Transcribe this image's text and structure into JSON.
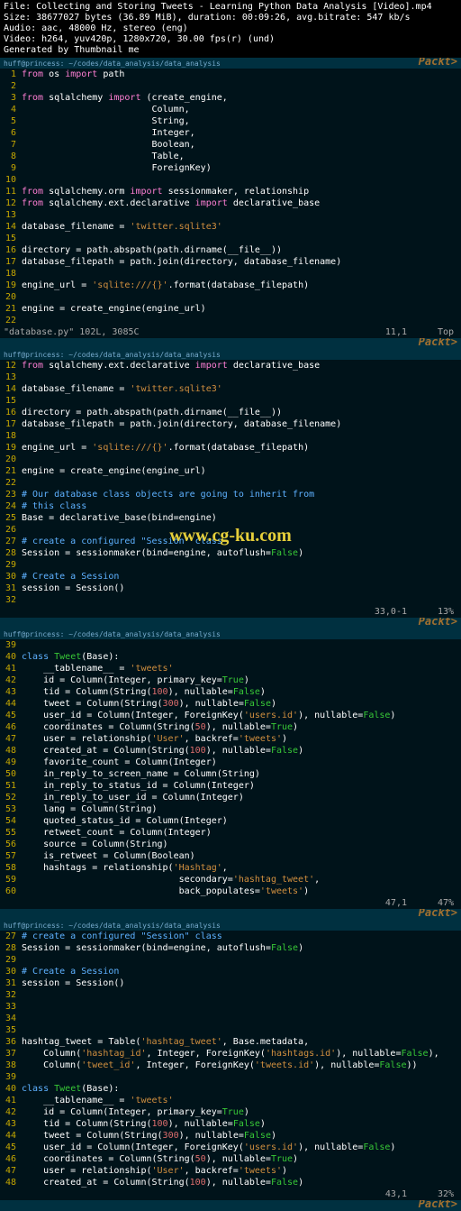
{
  "header": {
    "l1": "File: Collecting and Storing Tweets - Learning Python Data Analysis [Video].mp4",
    "l2": "Size: 38677027 bytes (36.89 MiB), duration: 00:09:26, avg.bitrate: 547 kb/s",
    "l3": "Audio: aac, 48000 Hz, stereo (eng)",
    "l4": "Video: h264, yuv420p, 1280x720, 30.00 fps(r) (und)",
    "l5": "Generated by Thumbnail me"
  },
  "bar": {
    "left": "huff@princess: ~/codes/data_analysis/data_analysis",
    "right_wm": "Packt>"
  },
  "pane1": {
    "lines": [
      {
        "n": 1,
        "t": [
          [
            "kw",
            "from"
          ],
          [
            "id",
            " os "
          ],
          [
            "kw",
            "import"
          ],
          [
            "id",
            " path"
          ]
        ]
      },
      {
        "n": 2,
        "t": []
      },
      {
        "n": 3,
        "t": [
          [
            "kw",
            "from"
          ],
          [
            "id",
            " sqlalchemy "
          ],
          [
            "kw",
            "import"
          ],
          [
            "id",
            " (create_engine,"
          ]
        ]
      },
      {
        "n": 4,
        "t": [
          [
            "id",
            "                        Column,"
          ]
        ]
      },
      {
        "n": 5,
        "t": [
          [
            "id",
            "                        String,"
          ]
        ]
      },
      {
        "n": 6,
        "t": [
          [
            "id",
            "                        Integer,"
          ]
        ]
      },
      {
        "n": 7,
        "t": [
          [
            "id",
            "                        Boolean,"
          ]
        ]
      },
      {
        "n": 8,
        "t": [
          [
            "id",
            "                        Table,"
          ]
        ]
      },
      {
        "n": 9,
        "t": [
          [
            "id",
            "                        ForeignKey)"
          ]
        ]
      },
      {
        "n": 10,
        "t": []
      },
      {
        "n": 11,
        "t": [
          [
            "kw",
            "from"
          ],
          [
            "id",
            " sqlalchemy.orm "
          ],
          [
            "kw",
            "import"
          ],
          [
            "id",
            " sessionmaker, relationship"
          ]
        ]
      },
      {
        "n": 12,
        "t": [
          [
            "kw",
            "from"
          ],
          [
            "id",
            " sqlalchemy.ext.declarative "
          ],
          [
            "kw",
            "import"
          ],
          [
            "id",
            " declarative_base"
          ]
        ]
      },
      {
        "n": 13,
        "t": []
      },
      {
        "n": 14,
        "t": [
          [
            "id",
            "database_filename = "
          ],
          [
            "str",
            "'twitter.sqlite3'"
          ]
        ]
      },
      {
        "n": 15,
        "t": []
      },
      {
        "n": 16,
        "t": [
          [
            "id",
            "directory = path.abspath(path.dirname(__file__))"
          ]
        ]
      },
      {
        "n": 17,
        "t": [
          [
            "id",
            "database_filepath = path.join(directory, database_filename)"
          ]
        ]
      },
      {
        "n": 18,
        "t": []
      },
      {
        "n": 19,
        "t": [
          [
            "id",
            "engine_url = "
          ],
          [
            "str",
            "'sqlite:///{}'"
          ],
          [
            "id",
            ".format(database_filepath)"
          ]
        ]
      },
      {
        "n": 20,
        "t": []
      },
      {
        "n": 21,
        "t": [
          [
            "id",
            "engine = create_engine(engine_url)"
          ]
        ]
      },
      {
        "n": 22,
        "t": []
      }
    ],
    "status_msg": "\"database.py\" 102L, 3085C",
    "status_pos": "11,1",
    "status_pct": "Top"
  },
  "pane2": {
    "lines": [
      {
        "n": 12,
        "t": [
          [
            "kw",
            "from"
          ],
          [
            "id",
            " sqlalchemy.ext.declarative "
          ],
          [
            "kw",
            "import"
          ],
          [
            "id",
            " declarative_base"
          ]
        ]
      },
      {
        "n": 13,
        "t": []
      },
      {
        "n": 14,
        "t": [
          [
            "id",
            "database_filename = "
          ],
          [
            "str",
            "'twitter.sqlite3'"
          ]
        ]
      },
      {
        "n": 15,
        "t": []
      },
      {
        "n": 16,
        "t": [
          [
            "id",
            "directory = path.abspath(path.dirname(__file__))"
          ]
        ]
      },
      {
        "n": 17,
        "t": [
          [
            "id",
            "database_filepath = path.join(directory, database_filename)"
          ]
        ]
      },
      {
        "n": 18,
        "t": []
      },
      {
        "n": 19,
        "t": [
          [
            "id",
            "engine_url = "
          ],
          [
            "str",
            "'sqlite:///{}'"
          ],
          [
            "id",
            ".format(database_filepath)"
          ]
        ]
      },
      {
        "n": 20,
        "t": []
      },
      {
        "n": 21,
        "t": [
          [
            "id",
            "engine = create_engine(engine_url)"
          ]
        ]
      },
      {
        "n": 22,
        "t": []
      },
      {
        "n": 23,
        "t": [
          [
            "cm",
            "# Our database class objects are going to inherit from"
          ]
        ]
      },
      {
        "n": 24,
        "t": [
          [
            "cm",
            "# this class"
          ]
        ]
      },
      {
        "n": 25,
        "t": [
          [
            "id",
            "Base = declarative_base(bind=engine)"
          ]
        ]
      },
      {
        "n": 26,
        "t": []
      },
      {
        "n": 27,
        "t": [
          [
            "cm",
            "# create a configured \"Session\" class"
          ]
        ]
      },
      {
        "n": 28,
        "t": [
          [
            "id",
            "Session = sessionmaker(bind=engine, autoflush="
          ],
          [
            "arg",
            "False"
          ],
          [
            "id",
            ")"
          ]
        ]
      },
      {
        "n": 29,
        "t": []
      },
      {
        "n": 30,
        "t": [
          [
            "cm",
            "# Create a Session"
          ]
        ]
      },
      {
        "n": 31,
        "t": [
          [
            "id",
            "session = Session()"
          ]
        ]
      },
      {
        "n": 32,
        "t": []
      }
    ],
    "status_pos": "33,0-1",
    "status_pct": "13%"
  },
  "pane3": {
    "lines": [
      {
        "n": 39,
        "t": []
      },
      {
        "n": 40,
        "t": [
          [
            "cls",
            "class"
          ],
          [
            "id",
            " "
          ],
          [
            "arg",
            "Tweet"
          ],
          [
            "id",
            "(Base):"
          ]
        ]
      },
      {
        "n": 41,
        "t": [
          [
            "id",
            "    __tablename__ = "
          ],
          [
            "str",
            "'tweets'"
          ]
        ]
      },
      {
        "n": 42,
        "t": [
          [
            "id",
            "    id = Column(Integer, primary_key="
          ],
          [
            "arg",
            "True"
          ],
          [
            "id",
            ")"
          ]
        ]
      },
      {
        "n": 43,
        "t": [
          [
            "id",
            "    tid = Column(String("
          ],
          [
            "num",
            "100"
          ],
          [
            "id",
            "), nullable="
          ],
          [
            "arg",
            "False"
          ],
          [
            "id",
            ")"
          ]
        ]
      },
      {
        "n": 44,
        "t": [
          [
            "id",
            "    tweet = Column(String("
          ],
          [
            "num",
            "300"
          ],
          [
            "id",
            "), nullable="
          ],
          [
            "arg",
            "False"
          ],
          [
            "id",
            ")"
          ]
        ]
      },
      {
        "n": 45,
        "t": [
          [
            "id",
            "    user_id = Column(Integer, ForeignKey("
          ],
          [
            "str",
            "'users.id'"
          ],
          [
            "id",
            "), nullable="
          ],
          [
            "arg",
            "False"
          ],
          [
            "id",
            ")"
          ]
        ]
      },
      {
        "n": 46,
        "t": [
          [
            "id",
            "    coordinates = Column(String("
          ],
          [
            "num",
            "50"
          ],
          [
            "id",
            "), nullable="
          ],
          [
            "arg",
            "True"
          ],
          [
            "id",
            ")"
          ]
        ]
      },
      {
        "n": 47,
        "t": [
          [
            "id",
            "    user = relationship("
          ],
          [
            "str",
            "'User'"
          ],
          [
            "id",
            ", backref="
          ],
          [
            "str",
            "'tweets'"
          ],
          [
            "id",
            ")"
          ]
        ]
      },
      {
        "n": 48,
        "t": [
          [
            "id",
            "    created_at = Column(String("
          ],
          [
            "num",
            "100"
          ],
          [
            "id",
            "), nullable="
          ],
          [
            "arg",
            "False"
          ],
          [
            "id",
            ")"
          ]
        ]
      },
      {
        "n": 49,
        "t": [
          [
            "id",
            "    favorite_count = Column(Integer)"
          ]
        ]
      },
      {
        "n": 50,
        "t": [
          [
            "id",
            "    in_reply_to_screen_name = Column(String)"
          ]
        ]
      },
      {
        "n": 51,
        "t": [
          [
            "id",
            "    in_reply_to_status_id = Column(Integer)"
          ]
        ]
      },
      {
        "n": 52,
        "t": [
          [
            "id",
            "    in_reply_to_user_id = Column(Integer)"
          ]
        ]
      },
      {
        "n": 53,
        "t": [
          [
            "id",
            "    lang = Column(String)"
          ]
        ]
      },
      {
        "n": 54,
        "t": [
          [
            "id",
            "    quoted_status_id = Column(Integer)"
          ]
        ]
      },
      {
        "n": 55,
        "t": [
          [
            "id",
            "    retweet_count = Column(Integer)"
          ]
        ]
      },
      {
        "n": 56,
        "t": [
          [
            "id",
            "    source = Column(String)"
          ]
        ]
      },
      {
        "n": 57,
        "t": [
          [
            "id",
            "    is_retweet = Column(Boolean)"
          ]
        ]
      },
      {
        "n": 58,
        "t": [
          [
            "id",
            "    hashtags = relationship("
          ],
          [
            "str",
            "'Hashtag'"
          ],
          [
            "id",
            ","
          ]
        ]
      },
      {
        "n": 59,
        "t": [
          [
            "id",
            "                             secondary="
          ],
          [
            "str",
            "'hashtag_tweet'"
          ],
          [
            "id",
            ","
          ]
        ]
      },
      {
        "n": 60,
        "t": [
          [
            "id",
            "                             back_populates="
          ],
          [
            "str",
            "'tweets'"
          ],
          [
            "id",
            ")"
          ]
        ]
      }
    ],
    "status_pos": "47,1",
    "status_pct": "47%"
  },
  "pane4": {
    "lines": [
      {
        "n": 27,
        "t": [
          [
            "cm",
            "# create a configured \"Session\" class"
          ]
        ]
      },
      {
        "n": 28,
        "t": [
          [
            "id",
            "Session = sessionmaker(bind=engine, autoflush="
          ],
          [
            "arg",
            "False"
          ],
          [
            "id",
            ")"
          ]
        ]
      },
      {
        "n": 29,
        "t": []
      },
      {
        "n": 30,
        "t": [
          [
            "cm",
            "# Create a Session"
          ]
        ]
      },
      {
        "n": 31,
        "t": [
          [
            "id",
            "session = Session()"
          ]
        ]
      },
      {
        "n": 32,
        "t": []
      },
      {
        "n": 33,
        "t": []
      },
      {
        "n": 34,
        "t": []
      },
      {
        "n": 35,
        "t": []
      },
      {
        "n": 36,
        "t": [
          [
            "id",
            "hashtag_tweet = Table("
          ],
          [
            "str",
            "'hashtag_tweet'"
          ],
          [
            "id",
            ", Base.metadata,"
          ]
        ]
      },
      {
        "n": 37,
        "t": [
          [
            "id",
            "    Column("
          ],
          [
            "str",
            "'hashtag_id'"
          ],
          [
            "id",
            ", Integer, ForeignKey("
          ],
          [
            "str",
            "'hashtags.id'"
          ],
          [
            "id",
            "), nullable="
          ],
          [
            "arg",
            "False"
          ],
          [
            "id",
            "),"
          ]
        ]
      },
      {
        "n": 38,
        "t": [
          [
            "id",
            "    Column("
          ],
          [
            "str",
            "'tweet_id'"
          ],
          [
            "id",
            ", Integer, ForeignKey("
          ],
          [
            "str",
            "'tweets.id'"
          ],
          [
            "id",
            "), nullable="
          ],
          [
            "arg",
            "False"
          ],
          [
            "id",
            "))"
          ]
        ]
      },
      {
        "n": 39,
        "t": []
      },
      {
        "n": 40,
        "t": [
          [
            "cls",
            "class"
          ],
          [
            "id",
            " "
          ],
          [
            "arg",
            "Tweet"
          ],
          [
            "id",
            "(Base):"
          ]
        ]
      },
      {
        "n": 41,
        "t": [
          [
            "id",
            "    __tablename__ = "
          ],
          [
            "str",
            "'tweets'"
          ]
        ]
      },
      {
        "n": 42,
        "t": [
          [
            "id",
            "    id = Column(Integer, primary_key="
          ],
          [
            "arg",
            "True"
          ],
          [
            "id",
            ")"
          ]
        ]
      },
      {
        "n": 43,
        "t": [
          [
            "id",
            "    tid = Column(String("
          ],
          [
            "num",
            "100"
          ],
          [
            "id",
            "), nullable="
          ],
          [
            "arg",
            "False"
          ],
          [
            "id",
            ")"
          ]
        ]
      },
      {
        "n": 44,
        "t": [
          [
            "id",
            "    tweet = Column(String("
          ],
          [
            "num",
            "300"
          ],
          [
            "id",
            "), nullable="
          ],
          [
            "arg",
            "False"
          ],
          [
            "id",
            ")"
          ]
        ]
      },
      {
        "n": 45,
        "t": [
          [
            "id",
            "    user_id = Column(Integer, ForeignKey("
          ],
          [
            "str",
            "'users.id'"
          ],
          [
            "id",
            "), nullable="
          ],
          [
            "arg",
            "False"
          ],
          [
            "id",
            ")"
          ]
        ]
      },
      {
        "n": 46,
        "t": [
          [
            "id",
            "    coordinates = Column(String("
          ],
          [
            "num",
            "50"
          ],
          [
            "id",
            "), nullable="
          ],
          [
            "arg",
            "True"
          ],
          [
            "id",
            ")"
          ]
        ]
      },
      {
        "n": 47,
        "t": [
          [
            "id",
            "    user = relationship("
          ],
          [
            "str",
            "'User'"
          ],
          [
            "id",
            ", backref="
          ],
          [
            "str",
            "'tweets'"
          ],
          [
            "id",
            ")"
          ]
        ]
      },
      {
        "n": 48,
        "t": [
          [
            "id",
            "    created_at = Column(String("
          ],
          [
            "num",
            "100"
          ],
          [
            "id",
            "), nullable="
          ],
          [
            "arg",
            "False"
          ],
          [
            "id",
            ")"
          ]
        ]
      }
    ],
    "status_pos": "43,1",
    "status_pct": "32%"
  },
  "watermark_url": "www.cg-ku.com"
}
